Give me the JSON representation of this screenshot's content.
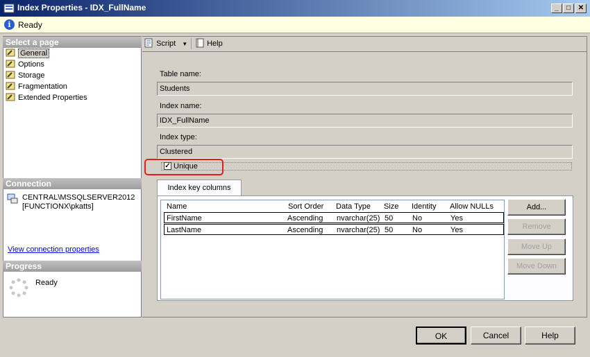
{
  "window": {
    "title": "Index Properties - IDX_FullName",
    "minimize": "_",
    "maximize": "□",
    "close": "✕"
  },
  "status": {
    "text": "Ready"
  },
  "left": {
    "select_page_header": "Select a page",
    "pages": [
      {
        "label": "General",
        "selected": true
      },
      {
        "label": "Options"
      },
      {
        "label": "Storage"
      },
      {
        "label": "Fragmentation"
      },
      {
        "label": "Extended Properties"
      }
    ],
    "connection_header": "Connection",
    "connection_server": "CENTRAL\\MSSQLSERVER2012",
    "connection_user": "[FUNCTIONX\\pkatts]",
    "view_connection_link": "View connection properties",
    "progress_header": "Progress",
    "progress_status": "Ready"
  },
  "toolbar": {
    "script_label": "Script",
    "help_label": "Help"
  },
  "form": {
    "table_name_label": "Table name:",
    "table_name_value": "Students",
    "index_name_label": "Index name:",
    "index_name_value": "IDX_FullName",
    "index_type_label": "Index type:",
    "index_type_value": "Clustered",
    "unique_label": "Unique",
    "unique_checked": true
  },
  "keys": {
    "tab_label": "Index key columns",
    "columns": [
      "Name",
      "Sort Order",
      "Data Type",
      "Size",
      "Identity",
      "Allow NULLs"
    ],
    "rows": [
      [
        "FirstName",
        "Ascending",
        "nvarchar(25)",
        "50",
        "No",
        "Yes"
      ],
      [
        "LastName",
        "Ascending",
        "nvarchar(25)",
        "50",
        "No",
        "Yes"
      ]
    ],
    "add_label": "Add...",
    "remove_label": "Remove",
    "move_up_label": "Move Up",
    "move_down_label": "Move Down"
  },
  "footer": {
    "ok_label": "OK",
    "cancel_label": "Cancel",
    "help_label": "Help"
  },
  "colors": {
    "highlight": "#e31c1c",
    "title_start": "#0a246a",
    "title_end": "#a6caf0"
  }
}
